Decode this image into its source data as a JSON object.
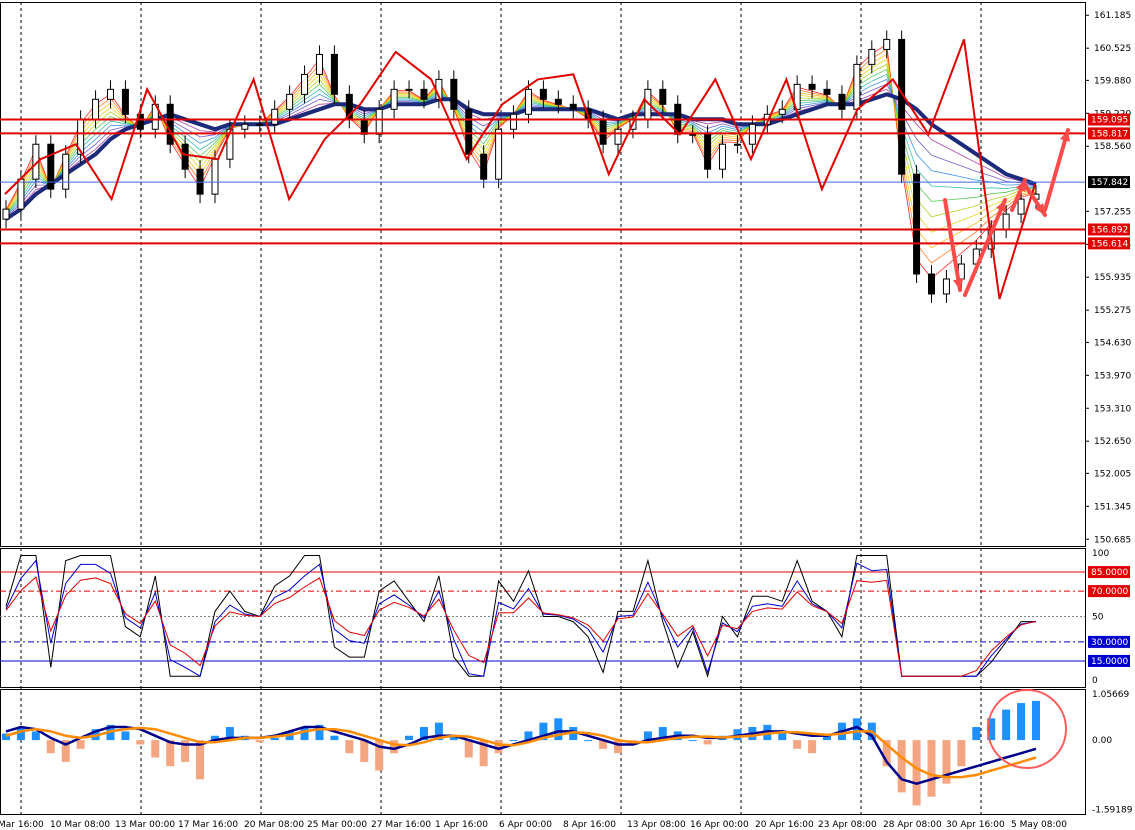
{
  "chart_data": {
    "type": "candlestick",
    "title": "",
    "main_price_ticks": [
      "161.185",
      "160.525",
      "159.880",
      "159.220",
      "158.560",
      "157.255",
      "156.595",
      "155.935",
      "155.275",
      "154.630",
      "153.970",
      "153.310",
      "152.650",
      "152.005",
      "151.345",
      "150.685"
    ],
    "price_range": [
      150.55,
      161.45
    ],
    "x_labels": [
      "Mar 16:00",
      "10 Mar 08:00",
      "13 Mar 00:00",
      "17 Mar 16:00",
      "20 Mar 08:00",
      "25 Mar 00:00",
      "27 Mar 16:00",
      "1 Apr 16:00",
      "6 Apr 00:00",
      "8 Apr 16:00",
      "13 Apr 08:00",
      "16 Apr 00:00",
      "20 Apr 16:00",
      "23 Apr 08:00",
      "28 Apr 08:00",
      "30 Apr 16:00",
      "5 May 08:00"
    ],
    "series": {
      "price_close": [
        157.3,
        157.9,
        158.6,
        157.7,
        158.4,
        159.1,
        159.5,
        159.7,
        159.2,
        158.9,
        159.4,
        158.6,
        158.1,
        157.6,
        158.3,
        158.9,
        159.0,
        159.0,
        159.3,
        159.6,
        160.0,
        160.4,
        159.6,
        159.1,
        158.8,
        159.3,
        159.7,
        159.7,
        159.5,
        159.9,
        159.3,
        158.4,
        157.9,
        158.9,
        159.2,
        159.7,
        159.5,
        159.4,
        159.3,
        159.1,
        158.6,
        158.9,
        159.1,
        159.7,
        159.4,
        158.8,
        158.8,
        158.1,
        158.6,
        158.6,
        159.0,
        159.2,
        159.3,
        159.8,
        159.7,
        159.6,
        159.3,
        160.2,
        160.5,
        160.7,
        158.0,
        156.0,
        155.6,
        155.9,
        156.2,
        156.5,
        156.9,
        157.2,
        157.5,
        157.6
      ],
      "ma_slow": [
        157.1,
        157.3,
        157.6,
        157.8,
        158.0,
        158.2,
        158.4,
        158.7,
        158.9,
        159.0,
        159.1,
        159.2,
        159.1,
        159.0,
        158.9,
        159.0,
        159.0,
        159.0,
        159.0,
        159.1,
        159.2,
        159.3,
        159.4,
        159.4,
        159.3,
        159.3,
        159.4,
        159.4,
        159.4,
        159.5,
        159.5,
        159.3,
        159.2,
        159.2,
        159.2,
        159.3,
        159.3,
        159.3,
        159.3,
        159.3,
        159.2,
        159.1,
        159.2,
        159.2,
        159.2,
        159.2,
        159.1,
        159.1,
        159.1,
        159.0,
        159.0,
        159.0,
        159.1,
        159.2,
        159.3,
        159.4,
        159.4,
        159.4,
        159.5,
        159.6,
        159.5,
        159.3,
        159.0,
        158.8,
        158.6,
        158.4,
        158.2,
        158.0,
        157.9,
        157.8
      ],
      "rsi_levels": {
        "upper": "85.0000",
        "high": "70.0000",
        "low": "30.0000",
        "lower": "15.0000"
      },
      "rsi_axis": [
        "100",
        "50",
        "0"
      ],
      "macd_axis": [
        "1.05669",
        "0.00",
        "-1.59189"
      ],
      "macd_hist": [
        0.15,
        0.3,
        0.2,
        -0.3,
        -0.5,
        -0.2,
        0.25,
        0.35,
        0.2,
        -0.1,
        -0.4,
        -0.6,
        -0.5,
        -0.9,
        0.1,
        0.3,
        0.1,
        -0.05,
        0.05,
        0.2,
        0.3,
        0.35,
        0.1,
        -0.3,
        -0.5,
        -0.7,
        -0.3,
        0.1,
        0.3,
        0.4,
        0.1,
        -0.4,
        -0.6,
        -0.3,
        0.0,
        0.2,
        0.4,
        0.5,
        0.3,
        0.0,
        -0.2,
        -0.3,
        -0.1,
        0.2,
        0.3,
        0.2,
        0.0,
        -0.1,
        0.1,
        0.25,
        0.3,
        0.35,
        0.2,
        -0.2,
        -0.3,
        0.1,
        0.4,
        0.5,
        0.4,
        -0.6,
        -1.2,
        -1.5,
        -1.3,
        -1.0,
        -0.6,
        0.3,
        0.5,
        0.7,
        0.85,
        0.9
      ],
      "macd_line": [
        0.2,
        0.3,
        0.25,
        0.05,
        -0.1,
        0.05,
        0.2,
        0.3,
        0.3,
        0.25,
        0.1,
        -0.05,
        -0.1,
        -0.1,
        0.0,
        0.05,
        0.05,
        0.05,
        0.1,
        0.2,
        0.3,
        0.3,
        0.2,
        0.1,
        0.0,
        -0.15,
        -0.2,
        -0.1,
        0.05,
        0.1,
        0.1,
        0.0,
        -0.1,
        -0.2,
        -0.1,
        0.0,
        0.1,
        0.2,
        0.2,
        0.1,
        0.0,
        -0.1,
        -0.1,
        0.0,
        0.05,
        0.1,
        0.1,
        0.05,
        0.05,
        0.1,
        0.15,
        0.2,
        0.2,
        0.15,
        0.1,
        0.1,
        0.2,
        0.3,
        0.1,
        -0.5,
        -0.9,
        -1.0,
        -0.9,
        -0.8,
        -0.7,
        -0.6,
        -0.5,
        -0.4,
        -0.3,
        -0.2
      ],
      "macd_signal": [
        0.1,
        0.2,
        0.25,
        0.2,
        0.1,
        0.05,
        0.1,
        0.2,
        0.25,
        0.28,
        0.25,
        0.15,
        0.05,
        -0.05,
        -0.05,
        0.0,
        0.05,
        0.05,
        0.08,
        0.12,
        0.2,
        0.25,
        0.25,
        0.2,
        0.1,
        0.0,
        -0.1,
        -0.12,
        -0.05,
        0.05,
        0.1,
        0.08,
        0.0,
        -0.1,
        -0.12,
        -0.05,
        0.05,
        0.12,
        0.18,
        0.16,
        0.1,
        0.0,
        -0.05,
        -0.05,
        0.0,
        0.05,
        0.08,
        0.08,
        0.06,
        0.08,
        0.1,
        0.15,
        0.18,
        0.18,
        0.15,
        0.12,
        0.15,
        0.2,
        0.2,
        -0.1,
        -0.4,
        -0.65,
        -0.8,
        -0.85,
        -0.85,
        -0.8,
        -0.7,
        -0.6,
        -0.5,
        -0.4
      ]
    },
    "horizontal_levels": [
      {
        "price": "159.095",
        "color": "#e00000"
      },
      {
        "price": "158.817",
        "color": "#e00000"
      },
      {
        "price": "157.842",
        "color": "#4169e1",
        "current": true
      },
      {
        "price": "156.892",
        "color": "#e00000"
      },
      {
        "price": "156.614",
        "color": "#e00000"
      }
    ],
    "zigzag": [
      157.6,
      158.3,
      158.6,
      157.5,
      159.7,
      158.4,
      158.3,
      159.9,
      157.5,
      158.7,
      159.4,
      160.45,
      159.9,
      158.3,
      159.4,
      159.9,
      160.0,
      158.0,
      159.5,
      158.8,
      159.9,
      158.3,
      159.9,
      157.7,
      159.3,
      159.9,
      158.8,
      160.7,
      155.5,
      157.8
    ],
    "colors": {
      "bull_candle": "#000000",
      "ma_slow": "#1c2a7a",
      "zigzag": "#e00000",
      "macd_up": "#1e90ff",
      "macd_down": "#f4a582",
      "macd_line": "#00008b",
      "macd_signal": "#ff8c00",
      "rsi_fast": "#000000",
      "rsi_mid": "#0000cd",
      "rsi_slow": "#e00000",
      "annotation": "#ff4a4a"
    },
    "grid": false
  }
}
